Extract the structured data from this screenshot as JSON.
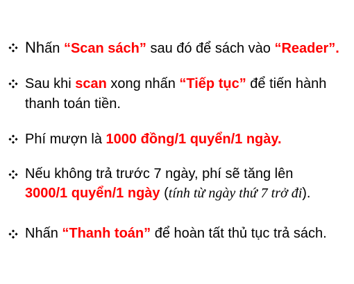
{
  "bullet_icon": "four-diamond-bullet-icon",
  "accent_color": "#ff0000",
  "items": [
    {
      "lines": [
        {
          "parts": [
            {
              "text": "Nh",
              "style": "big"
            },
            {
              "text": "ấn ",
              "style": "normal"
            },
            {
              "text": "“Scan sách”",
              "style": "red"
            },
            {
              "text": " sau đó để sách vào ",
              "style": "normal"
            },
            {
              "text": "“Reader”",
              "style": "red"
            },
            {
              "text": ".",
              "style": "red"
            }
          ]
        }
      ]
    },
    {
      "lines": [
        {
          "parts": [
            {
              "text": "Sau khi ",
              "style": "normal"
            },
            {
              "text": "scan",
              "style": "red"
            },
            {
              "text": " xong nhấn ",
              "style": "normal"
            },
            {
              "text": "“Tiếp tục”",
              "style": "red"
            },
            {
              "text": " để tiến hành",
              "style": "normal"
            }
          ]
        },
        {
          "parts": [
            {
              "text": "thanh toán tiền.",
              "style": "normal"
            }
          ]
        }
      ]
    },
    {
      "lines": [
        {
          "parts": [
            {
              "text": "Phí mượn là ",
              "style": "normal"
            },
            {
              "text": "1000 đồng/1 quyển/1 ngày.",
              "style": "red"
            }
          ]
        }
      ]
    },
    {
      "lines": [
        {
          "parts": [
            {
              "text": "Nếu không trả trước 7 ngày, phí sẽ tăng lên",
              "style": "normal"
            }
          ]
        },
        {
          "parts": [
            {
              "text": "3000/1 quyển/1 ngày",
              "style": "red"
            },
            {
              "text": " (",
              "style": "normal"
            },
            {
              "text": "tính từ ngày thứ 7 trở đi",
              "style": "serif_italic"
            },
            {
              "text": ").",
              "style": "normal"
            }
          ]
        }
      ]
    },
    {
      "lines": [
        {
          "parts": [
            {
              "text": "Nhấn ",
              "style": "normal"
            },
            {
              "text": "“Thanh toán”",
              "style": "red"
            },
            {
              "text": " để hoàn tất thủ tục trả sách.",
              "style": "normal"
            }
          ]
        }
      ]
    }
  ]
}
